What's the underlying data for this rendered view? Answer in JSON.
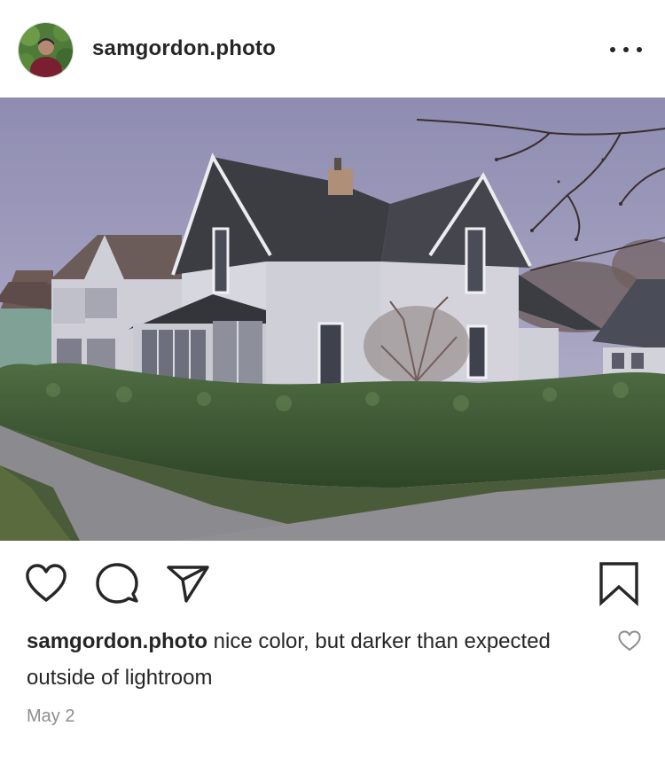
{
  "post": {
    "username": "samgordon.photo",
    "caption_username": "samgordon.photo",
    "caption_text": "nice color, but darker than expected outside of lightroom",
    "date": "May 2"
  },
  "icons": {
    "more": "more-options-icon",
    "like": "heart-icon",
    "comment": "comment-bubble-icon",
    "share": "paper-plane-icon",
    "save": "bookmark-icon",
    "caption_like": "small-heart-icon"
  },
  "colors": {
    "text": "#262626",
    "muted": "#8e8e8e",
    "sky": "#9b99b9",
    "house_siding": "#d4d4dc",
    "roof": "#3d3e44",
    "hedge": "#3e5a35"
  }
}
